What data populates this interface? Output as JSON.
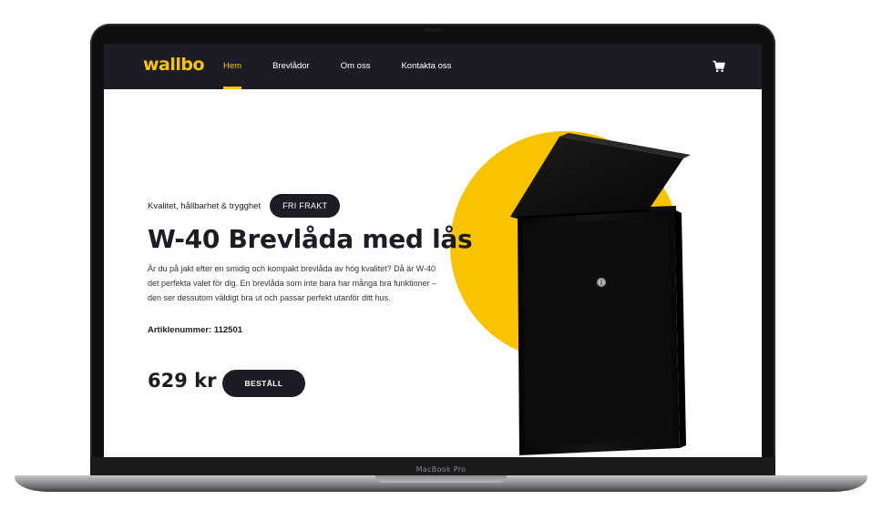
{
  "device": {
    "model_label": "MacBook Pro"
  },
  "header": {
    "logo": "wallbo",
    "nav": [
      {
        "label": "Hem",
        "active": true
      },
      {
        "label": "Brevlådor",
        "active": false
      },
      {
        "label": "Om oss",
        "active": false
      },
      {
        "label": "Kontakta oss",
        "active": false
      }
    ],
    "cart_icon": "cart-icon"
  },
  "hero": {
    "tagline": "Kvalitet, hållbarhet & trygghet",
    "badge": "FRI FRAKT",
    "title": "W-40 Brevlåda med lås",
    "description": "Är du på jakt efter en smidig och kompakt brevlåda av hög kvalitet? Då är W-40 det perfekta valet för dig. En brevlåda som inte bara har många bra funktioner – den ser dessutom väldigt bra ut och passar perfekt utanför ditt hus.",
    "sku": "Artiklenummer: 112501",
    "price": "629 kr",
    "order_button": "BESTÄLL"
  },
  "colors": {
    "accent": "#f6c400",
    "dark": "#1d1c24",
    "background": "#ffffff"
  }
}
